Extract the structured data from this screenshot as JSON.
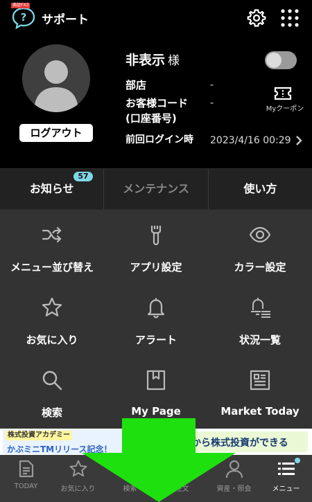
{
  "header": {
    "support_badge": "楽証FX3",
    "support_label": "サポート"
  },
  "profile": {
    "name": "非表示",
    "name_suffix": "様",
    "branch_label": "部店",
    "branch_value": "-",
    "customer_code_label_1": "お客様コード",
    "customer_code_label_2": "(口座番号)",
    "customer_code_value": "-",
    "last_login_label": "前回ログイン時",
    "last_login_value": "2023/4/16 00:29",
    "logout_label": "ログアウト",
    "coupon_label": "Myクーポン"
  },
  "tabs": [
    {
      "label": "お知らせ",
      "badge": "57"
    },
    {
      "label": "メンテナンス"
    },
    {
      "label": "使い方"
    }
  ],
  "menu": [
    {
      "label": "メニュー並び替え",
      "icon": "shuffle-icon"
    },
    {
      "label": "アプリ設定",
      "icon": "wrench-icon"
    },
    {
      "label": "カラー設定",
      "icon": "eye-icon"
    },
    {
      "label": "お気に入り",
      "icon": "star-icon"
    },
    {
      "label": "アラート",
      "icon": "bell-icon"
    },
    {
      "label": "状況一覧",
      "icon": "bell-list-icon"
    },
    {
      "label": "検索",
      "icon": "search-icon"
    },
    {
      "label": "My Page",
      "icon": "bookmark-icon"
    },
    {
      "label": "Market Today",
      "icon": "newspaper-icon"
    }
  ],
  "banner": {
    "tag": "株式投資アカデミー",
    "main": "かぶミニTMリリース記念！",
    "right": "から株式投資ができる"
  },
  "bottom_nav": [
    {
      "label": "TODAY",
      "icon": "document-icon"
    },
    {
      "label": "お気に入り",
      "icon": "star-icon"
    },
    {
      "label": "検索",
      "icon": "search-icon"
    },
    {
      "label": "注文",
      "icon": "order-icon"
    },
    {
      "label": "資産・照会",
      "icon": "person-icon"
    },
    {
      "label": "メニュー",
      "icon": "menu-icon",
      "active": true
    }
  ],
  "colors": {
    "badge": "#7fd6e6",
    "overlay_arrow": "#1fe00f"
  }
}
